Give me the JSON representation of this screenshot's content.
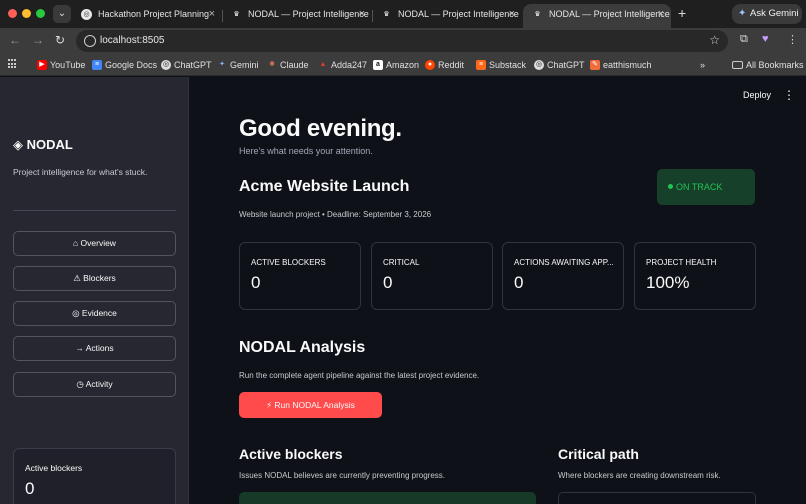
{
  "browser": {
    "tabs": [
      {
        "title": "Hackathon Project Planning",
        "active": false
      },
      {
        "title": "NODAL — Project Intelligence",
        "active": false
      },
      {
        "title": "NODAL — Project Intelligence",
        "active": false
      },
      {
        "title": "NODAL — Project Intelligence",
        "active": true
      }
    ],
    "new_tab_icon": "plus-icon",
    "ask_gemini_label": "Ask Gemini",
    "url": "localhost:8505",
    "bookmarks": [
      "YouTube",
      "Google Docs",
      "ChatGPT",
      "Gemini",
      "Claude",
      "Adda247",
      "Amazon",
      "Reddit",
      "Substack",
      "ChatGPT",
      "eatthismuch"
    ],
    "all_bookmarks_label": "All Bookmarks"
  },
  "header": {
    "deploy_label": "Deploy"
  },
  "sidebar": {
    "brand": "NODAL",
    "tagline": "Project intelligence for what's stuck.",
    "nav": [
      {
        "label": "⌂ Overview"
      },
      {
        "label": "⚠ Blockers"
      },
      {
        "label": "◎ Evidence"
      },
      {
        "label": "→ Actions"
      },
      {
        "label": "◷ Activity"
      }
    ],
    "metric": {
      "label": "Active blockers",
      "value": "0"
    }
  },
  "main": {
    "greeting": "Good evening.",
    "subtitle": "Here's what needs your attention.",
    "project": {
      "name": "Acme Website Launch",
      "meta": "Website launch project • Deadline: September 3, 2026",
      "status": "ON TRACK",
      "status_color": "#21c354"
    },
    "kpis": [
      {
        "label": "ACTIVE BLOCKERS",
        "value": "0"
      },
      {
        "label": "CRITICAL",
        "value": "0"
      },
      {
        "label": "ACTIONS AWAITING APP...",
        "value": "0"
      },
      {
        "label": "PROJECT HEALTH",
        "value": "100%"
      }
    ],
    "analysis": {
      "title": "NODAL Analysis",
      "description": "Run the complete agent pipeline against the latest project evidence.",
      "button_label": "⚡ Run NODAL Analysis",
      "button_color": "#ff4b4b"
    },
    "active_blockers": {
      "title": "Active blockers",
      "description": "Issues NODAL believes are currently preventing progress."
    },
    "critical_path": {
      "title": "Critical path",
      "description": "Where blockers are creating downstream risk."
    }
  }
}
